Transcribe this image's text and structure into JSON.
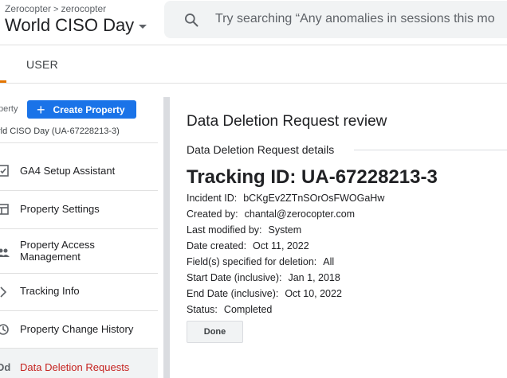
{
  "header": {
    "breadcrumb": [
      "Zerocopter",
      "zerocopter"
    ],
    "account_title": "World CISO Day",
    "search_placeholder": "Try searching “Any anomalies in sessions this mo"
  },
  "tabs": {
    "user": "USER"
  },
  "sidebar": {
    "property_label": "perty",
    "create_property": "Create Property",
    "property_name": "rld CISO Day (UA-67228213-3)",
    "items": [
      {
        "label": "GA4 Setup Assistant",
        "icon": "clipboard-check-icon"
      },
      {
        "label": "Property Settings",
        "icon": "layout-icon"
      },
      {
        "label": "Property Access Management",
        "icon": "people-icon"
      },
      {
        "label": "Tracking Info",
        "icon": "chevron-right-icon"
      },
      {
        "label": "Property Change History",
        "icon": "history-icon"
      },
      {
        "label": "Data Deletion Requests",
        "icon": "dd-icon"
      }
    ]
  },
  "main": {
    "title": "Data Deletion Request review",
    "subtitle": "Data Deletion Request details",
    "tracking_id": "Tracking ID:  UA-67228213-3",
    "details": [
      {
        "label": "Incident ID:",
        "value": "bCKgEv2ZTnSOrOsFWOGaHw"
      },
      {
        "label": "Created by:",
        "value": "chantal@zerocopter.com"
      },
      {
        "label": "Last modified by:",
        "value": "System"
      },
      {
        "label": "Date created:",
        "value": "Oct 11, 2022"
      },
      {
        "label": "Field(s) specified for deletion:",
        "value": "All"
      },
      {
        "label": "Start Date (inclusive):",
        "value": "Jan 1, 2018"
      },
      {
        "label": "End Date (inclusive):",
        "value": "Oct 10, 2022"
      },
      {
        "label": "Status:",
        "value": "Completed"
      }
    ],
    "done": "Done"
  },
  "colors": {
    "accent": "#1a73e8",
    "active_text": "#c5221f",
    "tab_indicator": "#e37400"
  }
}
